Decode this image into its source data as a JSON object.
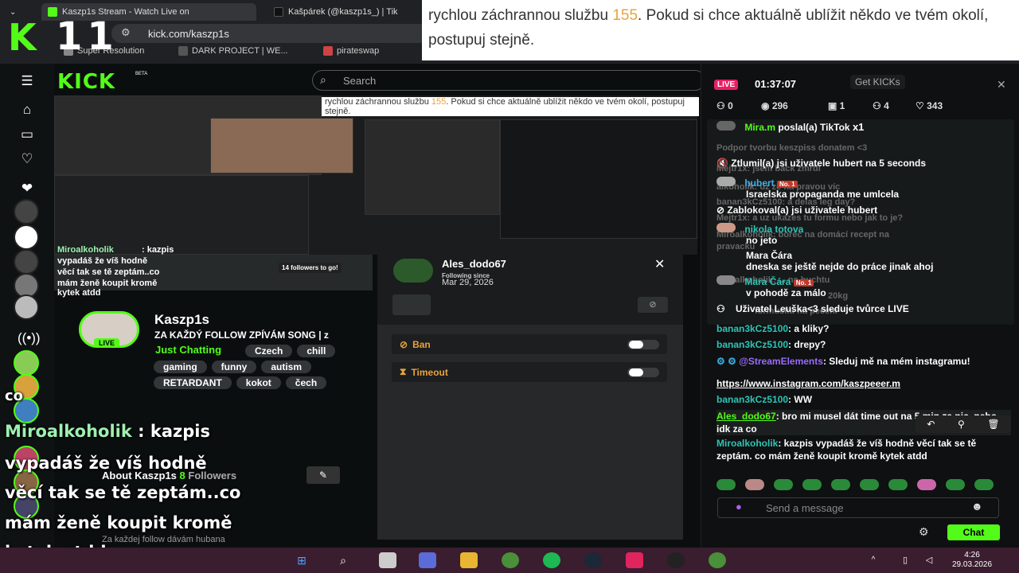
{
  "browser": {
    "tabs": [
      {
        "label": "Kaszp1s Stream - Watch Live on"
      },
      {
        "label": "Kašpárek (@kaszp1s_) | Tik"
      }
    ],
    "url": "kick.com/kaszp1s",
    "bookmarks": [
      "Super Resolution",
      "DARK PROJECT | WE...",
      "pirateswap"
    ]
  },
  "overlay": {
    "logo_k": "K",
    "logo_num": "11",
    "alert_text_1": "rychlou záchrannou službu ",
    "alert_number": "155",
    "alert_text_2": ". Pokud si chce aktuálně ublížit někdo ve tvém okolí, postupuj stejně.",
    "big_chat": {
      "co": "co",
      "name": "Miroalkoholik",
      "colon": " : kazpis",
      "line1": "vypadáš že víš hodně",
      "line2": "věcí tak se tě zeptám..co",
      "line3": "mám ženě koupit kromě",
      "line4": "kytek atdd"
    }
  },
  "kick": {
    "logo": "KICK",
    "beta": "BETA",
    "search_placeholder": "Search",
    "mini_banner_1": "rychlou záchrannou službu ",
    "mini_banner_num": "155",
    "mini_banner_2": ". Pokud si chce aktuálně ublížit někdo ve tvém okolí, postupuj stejně.",
    "streamer": {
      "name": "Kaszp1s",
      "live": "LIVE",
      "title": "ZA KAŽDÝ FOLLOW ZPÍVÁM SONG | z",
      "category": "Just Chatting",
      "tags_row1": [
        "Czech",
        "chill"
      ],
      "tags_row2": [
        "gaming",
        "funny",
        "autism"
      ],
      "tags_row3": [
        "RETARDANT",
        "kokot",
        "čech"
      ]
    },
    "about": {
      "label": "About Kaszp1s",
      "followers_count": "8",
      "followers_label": "Followers",
      "description": "Za každej follow dávám hubana"
    },
    "ghost_chat": {
      "name": "Miroalkoholik",
      "line1": ": kazpis",
      "line2": "vypadáš že víš hodně",
      "line3": "věcí tak se tě zeptám..co",
      "line4": "mám ženě koupit kromě",
      "line5": "kytek atdd",
      "followers_goal": "14 followers to go!"
    },
    "profile_card": {
      "username": "Ales_dodo67",
      "following_label": "Following since",
      "following_date": "Mar 29, 2026",
      "ban_label": "Ban",
      "timeout_label": "Timeout"
    }
  },
  "chat": {
    "live": "LIVE",
    "uptime": "01:37:07",
    "get_kicks": "Get KICKs",
    "stats": {
      "subs": "0",
      "viewers": "296",
      "tier": "1",
      "users": "4",
      "likes": "343"
    },
    "pinned": [
      {
        "user": "Mira.m",
        "text": " poslal(a) TikTok ",
        "extra": "x1"
      },
      {
        "user": "",
        "text": "Ztlumil(a) jsi uživatele hubert na 5 seconds"
      },
      {
        "user": "hubert",
        "badge": "No. 1",
        "text": "Israelska propaganda me umlcela"
      },
      {
        "user": "",
        "text": "Zablokoval(a) jsi uživatele hubert"
      },
      {
        "user": "nikola totova",
        "text": "no jeto"
      },
      {
        "user": "Mara Čára",
        "text": "dneska se ještě nejde do práce jinak ahoj"
      },
      {
        "user": "Mara Čára",
        "badge": "No. 1",
        "text": "v pohodě za málo"
      },
      {
        "user": "",
        "text": "Uživatel Leuška<3  sleduje tvůrce LIVE"
      }
    ],
    "ghost_lines": [
      "Podpor tvorbu keszpiss donatem <3",
      "Mejtr1x: jsem back zmrdi",
      "alkoholik: uz ze na pravou víc",
      "banan3kCz5100: a delas leg day?",
      "Mejtr1x: a uz ukazes tu formu nebo jak to je?",
      "Miroalkoholik: borec na domácí recept na",
      "pravacku",
      "Miroalkoholik: ... na buchtu",
      "20kg",
      "formucku na pecení"
    ],
    "messages": [
      {
        "user": "banan3kCz5100",
        "text": ": a kliky?"
      },
      {
        "user": "banan3kCz5100",
        "text": ": drepy?"
      },
      {
        "user": "@StreamElements",
        "text": ": Sleduj mě na mém instagramu!"
      },
      {
        "link": "https://www.instagram.com/kaszpeeer.m"
      },
      {
        "user": "banan3kCz5100",
        "text": ": WW"
      },
      {
        "user": "Ales_dodo67",
        "text": ": bro mi musel dát time out na 5 min za nic, nebo idk za co"
      },
      {
        "user": "Miroalkoholik",
        "text": ": kazpis vypadáš že víš hodně věcí tak se tě zeptám. co mám ženě koupit kromě kytek atdd"
      }
    ],
    "input_placeholder": "Send a message",
    "chat_button": "Chat"
  },
  "taskbar": {
    "time": "4:26",
    "date": "29.03.2026"
  },
  "colors": {
    "kick_green": "#53fc18",
    "live_pink": "#e91e63",
    "alert_orange": "#e8a23c"
  }
}
